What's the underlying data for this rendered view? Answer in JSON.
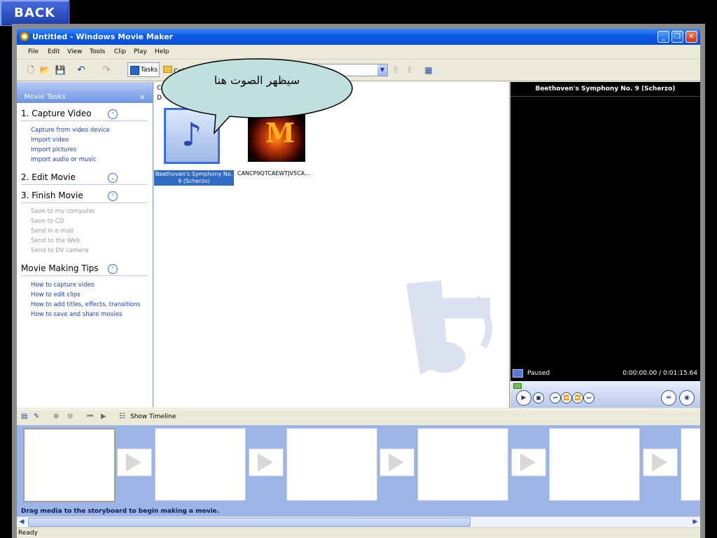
{
  "overlay": {
    "back_label": "BACK",
    "callout_text": "سيظهر الصوت هنا"
  },
  "window": {
    "title": "Untitled - Windows Movie Maker",
    "minimize_glyph": "_",
    "maximize_glyph": "❐",
    "close_glyph": "✕"
  },
  "menu": [
    "File",
    "Edit",
    "View",
    "Tools",
    "Clip",
    "Play",
    "Help"
  ],
  "toolbar": {
    "new_icon": "new-project-icon",
    "open_icon": "open-project-icon",
    "save_icon": "save-project-icon",
    "undo_icon": "undo-icon",
    "redo_icon": "redo-icon",
    "tasks_label": "Tasks",
    "collections_label": "Col"
  },
  "tasks": {
    "header": "Movie Tasks",
    "close_glyph": "×",
    "sections": [
      {
        "title": "1. Capture Video",
        "toggle": "⌃",
        "links": [
          "Capture from video device",
          "Import video",
          "Import pictures",
          "Import audio or music"
        ]
      },
      {
        "title": "2. Edit Movie",
        "toggle": "⌄",
        "links": []
      },
      {
        "title": "3. Finish Movie",
        "toggle": "⌃",
        "links": [
          "Save to my computer",
          "Save to CD",
          "Send in e-mail",
          "Send to the Web",
          "Send to DV camera"
        ]
      },
      {
        "title": "Movie Making Tips",
        "toggle": "⌃",
        "links": [
          "How to capture video",
          "How to edit clips",
          "How to add titles, effects, transitions",
          "How to save and share movies"
        ]
      }
    ]
  },
  "collection": {
    "header_line1": "C",
    "header_line2": "D",
    "items": [
      {
        "caption": "Beethoven's Symphony No. 9 (Scherzo)"
      },
      {
        "caption": "CANCP9QTCAEWTJV5CA..."
      }
    ]
  },
  "preview": {
    "title": "Beethoven's Symphony No. 9 (Scherzo)",
    "status": "Paused",
    "time": "0:00:00.00 / 0:01:15.64"
  },
  "timeline": {
    "show_timeline_label": "Show Timeline"
  },
  "storyboard": {
    "hint": "Drag media to the storyboard to begin making a movie."
  },
  "statusbar": {
    "text": "Ready"
  }
}
